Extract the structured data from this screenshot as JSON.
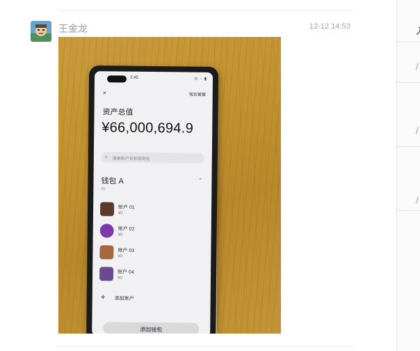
{
  "message": {
    "sender": "王金龙",
    "time": "12-12 14:53"
  },
  "right_panel": {
    "items": [
      "入",
      "/",
      "/",
      "/"
    ]
  },
  "phone_screen": {
    "status_time": "2:45",
    "status_icons": "⊙ ◦ ▮",
    "close_icon": "×",
    "wallet_management": "钱包管理",
    "assets_label": "资产总值",
    "assets_value": "¥66,000,694.9",
    "search_placeholder": "搜索账户名称或地址",
    "wallet_name": "钱包 A",
    "wallet_sub": "(6)",
    "accounts": [
      {
        "name": "账户 01",
        "balance": "¥0",
        "color": "#5a3b2b"
      },
      {
        "name": "账户 02",
        "balance": "¥0",
        "color": "#7b3aa8"
      },
      {
        "name": "账户 03",
        "balance": "¥0",
        "color": "#a5673d"
      },
      {
        "name": "账户 04",
        "balance": "¥0",
        "color": "#6a4b92"
      }
    ],
    "add_account": "添加账户",
    "add_wallet": "添加钱包"
  }
}
